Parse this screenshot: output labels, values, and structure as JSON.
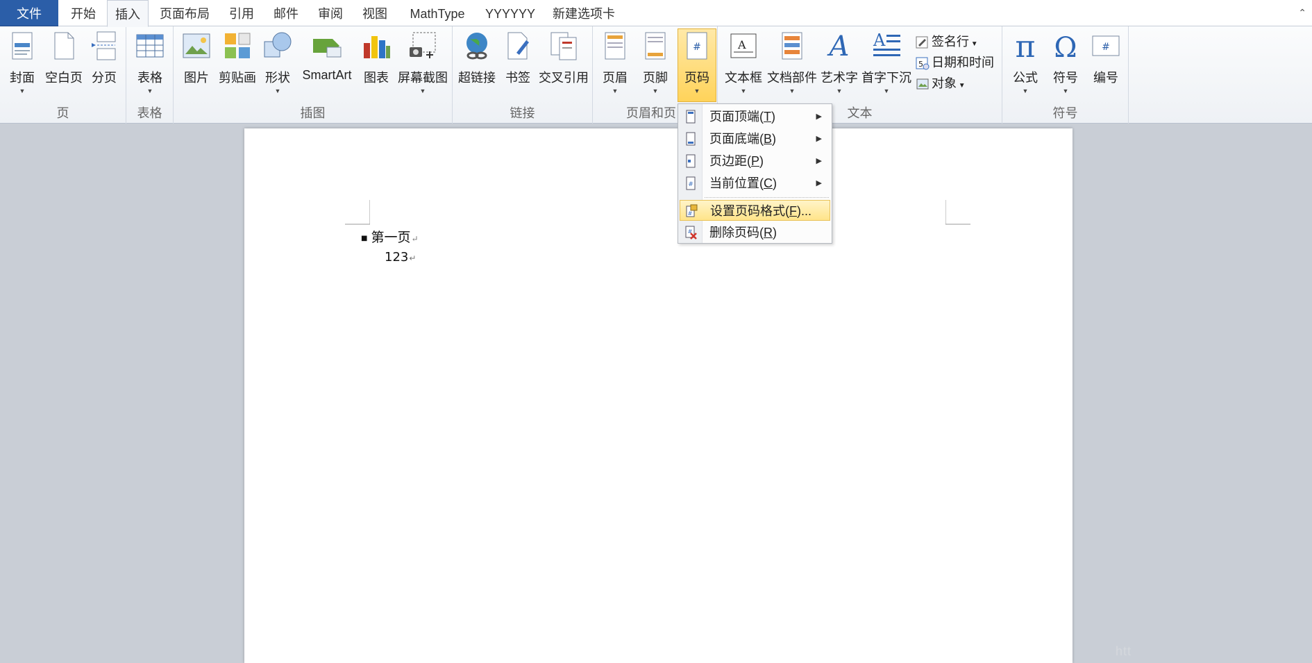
{
  "tabs": [
    {
      "label": "文件",
      "kind": "file"
    },
    {
      "label": "开始"
    },
    {
      "label": "插入",
      "active": true
    },
    {
      "label": "页面布局"
    },
    {
      "label": "引用"
    },
    {
      "label": "邮件"
    },
    {
      "label": "审阅"
    },
    {
      "label": "视图"
    },
    {
      "label": "MathType"
    },
    {
      "label": "YYYYYY"
    },
    {
      "label": "新建选项卡"
    }
  ],
  "ribbon": {
    "groups": {
      "pages": "页",
      "tables": "表格",
      "illustrations": "插图",
      "links": "链接",
      "header_footer": "页眉和页",
      "text": "文本",
      "symbols": "符号"
    },
    "buttons": {
      "cover": "封面",
      "blank_page": "空白页",
      "page_break": "分页",
      "table": "表格",
      "picture": "图片",
      "clip_art": "剪贴画",
      "shapes": "形状",
      "smartart": "SmartArt",
      "chart": "图表",
      "screenshot": "屏幕截图",
      "hyperlink": "超链接",
      "bookmark": "书签",
      "cross_ref": "交叉引用",
      "header": "页眉",
      "footer": "页脚",
      "page_number": "页码",
      "text_box": "文本框",
      "quick_parts": "文档部件",
      "wordart": "艺术字",
      "drop_cap": "首字下沉",
      "signature_line": "签名行",
      "date_time": "日期和时间",
      "object": "对象",
      "equation": "公式",
      "symbol": "符号",
      "numbering": "编号"
    }
  },
  "menu": {
    "items": [
      {
        "text": "页面顶端(",
        "key": "T",
        "tail": ")",
        "submenu": true
      },
      {
        "text": "页面底端(",
        "key": "B",
        "tail": ")",
        "submenu": true
      },
      {
        "text": "页边距(",
        "key": "P",
        "tail": ")",
        "submenu": true
      },
      {
        "text": "当前位置(",
        "key": "C",
        "tail": ")",
        "submenu": true
      },
      {
        "text": "设置页码格式(",
        "key": "F",
        "tail": ")...",
        "highlighted": true
      },
      {
        "text": "删除页码(",
        "key": "R",
        "tail": ")"
      }
    ]
  },
  "document": {
    "line1": "第一页",
    "line2": "123",
    "para_mark": "↵"
  },
  "watermark": "htt",
  "colors": {
    "file_tab": "#2b5ea8",
    "highlight": "#ffe48a",
    "doc_bg": "#c9ced6"
  }
}
